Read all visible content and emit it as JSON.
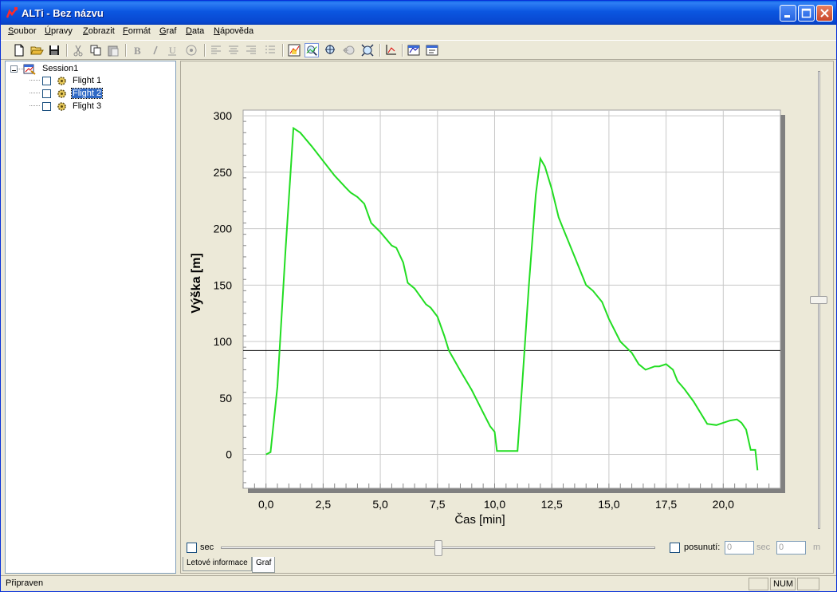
{
  "window": {
    "title": "ALTi - Bez názvu"
  },
  "menu": [
    "Soubor",
    "Úpravy",
    "Zobrazit",
    "Formát",
    "Graf",
    "Data",
    "Nápověda"
  ],
  "toolbar": {
    "buttons": [
      "new-icon",
      "open-icon",
      "save-icon",
      "cut-icon",
      "copy-icon",
      "paste-icon",
      "bold-icon",
      "italic-icon",
      "underline-icon",
      "font-icon",
      "align-left-icon",
      "align-center-icon",
      "align-right-icon",
      "list-icon",
      "graph-settings-icon",
      "zoom-in-icon",
      "zoom-move-icon",
      "zoom-back-icon",
      "zoom-fit-icon",
      "axis-icon",
      "chart-options-icon",
      "properties-icon"
    ]
  },
  "tree": {
    "root": "Session1",
    "items": [
      {
        "label": "Flight 1",
        "checked": false,
        "selected": false
      },
      {
        "label": "Flight 2",
        "checked": false,
        "selected": true
      },
      {
        "label": "Flight 3",
        "checked": false,
        "selected": false
      }
    ]
  },
  "chart_data": {
    "type": "line",
    "xlabel": "Čas [min]",
    "ylabel": "Výška [m]",
    "xlim": [
      -1.0,
      22.5
    ],
    "ylim": [
      -30,
      305
    ],
    "xticks": [
      0,
      2.5,
      5,
      7.5,
      10,
      12.5,
      15,
      17.5,
      20
    ],
    "xtick_labels": [
      "0,0",
      "2,5",
      "5,0",
      "7,5",
      "10,0",
      "12,5",
      "15,0",
      "17,5",
      "20,0"
    ],
    "yticks": [
      0,
      50,
      100,
      150,
      200,
      250,
      300
    ],
    "ytick_labels": [
      "0",
      "50",
      "100",
      "150",
      "200",
      "250",
      "300"
    ],
    "grid": true,
    "reference_line_y": 92,
    "series_color": "#22dd22",
    "series": [
      {
        "x": [
          0.0,
          0.2,
          0.5,
          0.85,
          1.2,
          1.5,
          2.0,
          2.5,
          3.0,
          3.5,
          3.7,
          4.0,
          4.3,
          4.6,
          5.0,
          5.5,
          5.7,
          6.0,
          6.2,
          6.5,
          7.0,
          7.2,
          7.5,
          7.8,
          8.0,
          8.5,
          9.0,
          9.5,
          9.8,
          10.0,
          10.1,
          10.2,
          10.5,
          11.0,
          11.2,
          11.5,
          11.8,
          12.0,
          12.2,
          12.5,
          12.8,
          13.0,
          13.5,
          14.0,
          14.3,
          14.7,
          15.0,
          15.5,
          16.0,
          16.3,
          16.6,
          17.0,
          17.2,
          17.5,
          17.8,
          18.0,
          18.3,
          18.7,
          19.0,
          19.3,
          19.7,
          20.0,
          20.3,
          20.6,
          20.8,
          21.0,
          21.2,
          21.4,
          21.5
        ],
        "y": [
          0,
          2,
          60,
          180,
          289,
          285,
          273,
          260,
          247,
          236,
          232,
          228,
          222,
          205,
          197,
          185,
          183,
          170,
          152,
          147,
          133,
          130,
          122,
          105,
          92,
          74,
          57,
          37,
          25,
          20,
          3,
          3,
          3,
          3,
          60,
          150,
          230,
          262,
          255,
          235,
          210,
          200,
          175,
          150,
          145,
          135,
          120,
          100,
          90,
          80,
          75,
          78,
          78,
          80,
          75,
          65,
          58,
          47,
          37,
          27,
          26,
          28,
          30,
          31,
          28,
          22,
          4,
          4,
          -14
        ]
      }
    ]
  },
  "bottom_controls": {
    "sec_checkbox_label": "sec",
    "shift_checkbox_label": "posunutí:",
    "shift_sec_value": "0",
    "shift_sec_unit": "sec",
    "shift_m_value": "0",
    "shift_m_unit": "m"
  },
  "tabs": [
    {
      "label": "Letové informace",
      "active": false
    },
    {
      "label": "Graf",
      "active": true
    }
  ],
  "status": {
    "text": "Připraven",
    "num": "NUM"
  }
}
